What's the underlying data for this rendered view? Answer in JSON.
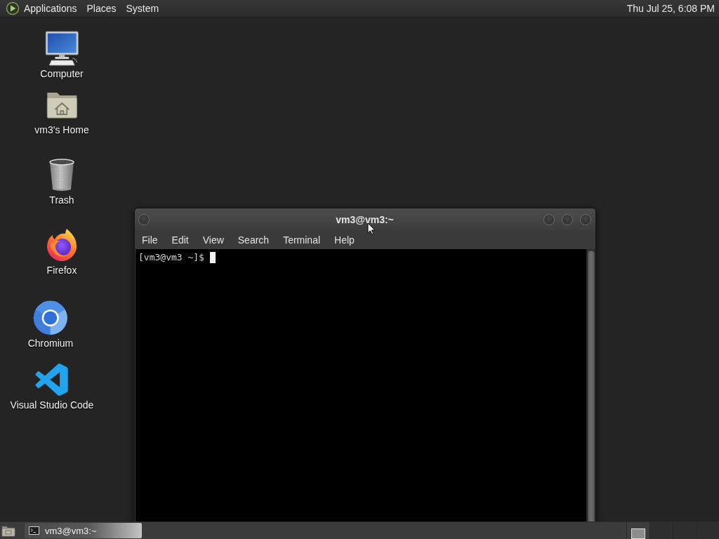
{
  "top_panel": {
    "menus": [
      "Applications",
      "Places",
      "System"
    ],
    "clock": "Thu Jul 25, 6:08 PM"
  },
  "desktop_icons": [
    {
      "kind": "computer",
      "label": "Computer"
    },
    {
      "kind": "home",
      "label": "vm3's Home"
    },
    {
      "kind": "trash",
      "label": "Trash"
    },
    {
      "kind": "firefox",
      "label": "Firefox"
    },
    {
      "kind": "chromium",
      "label": "Chromium"
    },
    {
      "kind": "vscode",
      "label": "Visual Studio Code"
    }
  ],
  "terminal_window": {
    "title": "vm3@vm3:~",
    "menu": [
      "File",
      "Edit",
      "View",
      "Search",
      "Terminal",
      "Help"
    ],
    "prompt": "[vm3@vm3 ~]$"
  },
  "taskbar": {
    "tasks": [
      {
        "label": "vm3@vm3:~",
        "selected": true
      }
    ],
    "workspaces": [
      {
        "selected": true,
        "has_window": true
      },
      {
        "selected": false,
        "has_window": false
      },
      {
        "selected": false,
        "has_window": false
      },
      {
        "selected": false,
        "has_window": false
      }
    ]
  }
}
